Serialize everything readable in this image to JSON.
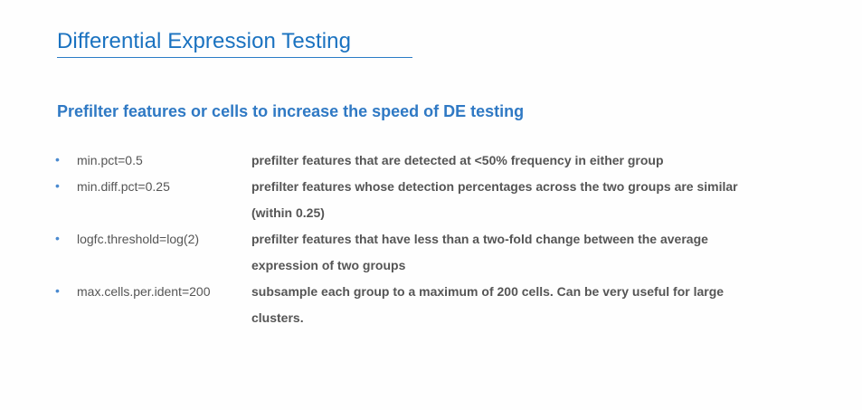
{
  "slide": {
    "title": "Differential Expression Testing",
    "subtitle": "Prefilter features or cells to increase the speed of DE testing",
    "bullet_symbol": "•",
    "params": [
      {
        "name": "min.pct=0.5",
        "description": "prefilter features that are detected at <50% frequency in either group"
      },
      {
        "name": "min.diff.pct=0.25",
        "description": "prefilter features whose detection percentages across the two groups are similar (within 0.25)"
      },
      {
        "name": "logfc.threshold=log(2)",
        "description": "prefilter features that have less than a two-fold change between the average expression of two groups"
      },
      {
        "name": "max.cells.per.ident=200",
        "description": "subsample each group to a maximum of 200 cells. Can be very useful for large clusters."
      }
    ]
  },
  "colors": {
    "title": "#1a72c0",
    "subtitle": "#2f79c4",
    "bullet": "#4a8ad0",
    "body_text": "#555555",
    "background": "#fefefe"
  }
}
